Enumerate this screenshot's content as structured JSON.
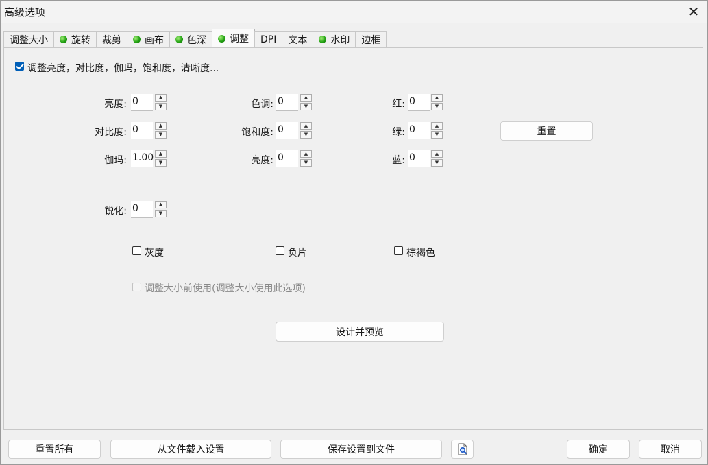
{
  "window": {
    "title": "高级选项",
    "close_icon": "close-icon"
  },
  "tabs": [
    {
      "label": "调整大小",
      "dot": false
    },
    {
      "label": "旋转",
      "dot": true
    },
    {
      "label": "裁剪",
      "dot": false
    },
    {
      "label": "画布",
      "dot": true
    },
    {
      "label": "色深",
      "dot": true
    },
    {
      "label": "调整",
      "dot": true,
      "active": true
    },
    {
      "label": "DPI",
      "dot": false
    },
    {
      "label": "文本",
      "dot": false
    },
    {
      "label": "水印",
      "dot": true
    },
    {
      "label": "边框",
      "dot": false
    }
  ],
  "adjust": {
    "enable_label": "调整亮度，对比度，伽玛，饱和度，清晰度...",
    "enable_checked": true,
    "brightness": {
      "label": "亮度:",
      "value": "0"
    },
    "contrast": {
      "label": "对比度:",
      "value": "0"
    },
    "gamma": {
      "label": "伽玛:",
      "value": "1.00"
    },
    "hue": {
      "label": "色调:",
      "value": "0"
    },
    "saturation": {
      "label": "饱和度:",
      "value": "0"
    },
    "lightness": {
      "label": "亮度:",
      "value": "0"
    },
    "red": {
      "label": "红:",
      "value": "0"
    },
    "green": {
      "label": "绿:",
      "value": "0"
    },
    "blue": {
      "label": "蓝:",
      "value": "0"
    },
    "sharpen": {
      "label": "锐化:",
      "value": "0"
    },
    "reset_label": "重置",
    "grayscale_label": "灰度",
    "negative_label": "负片",
    "sepia_label": "棕褐色",
    "before_resize_label": "调整大小前使用(调整大小使用此选项)",
    "design_preview_label": "设计并预览"
  },
  "footer": {
    "reset_all": "重置所有",
    "load_from_file": "从文件载入设置",
    "save_to_file": "保存设置到文件",
    "preview_icon": "file-search-icon",
    "ok": "确定",
    "cancel": "取消"
  },
  "colors": {
    "accent": "#005fb8",
    "dot_green": "#23a213"
  }
}
